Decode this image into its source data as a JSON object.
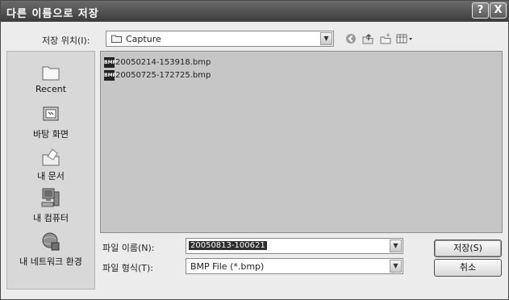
{
  "window": {
    "title": "다른 이름으로 저장",
    "help_label": "?",
    "close_label": "X"
  },
  "look_in": {
    "label": "저장 위치(I):",
    "value": "Capture"
  },
  "toolbar": {
    "icons": [
      "back-icon",
      "up-folder-icon",
      "new-folder-icon",
      "view-menu-icon"
    ]
  },
  "places": [
    {
      "label": "Recent",
      "icon": "recent-documents-icon"
    },
    {
      "label": "바탕 화면",
      "icon": "desktop-icon"
    },
    {
      "label": "내 문서",
      "icon": "my-documents-icon"
    },
    {
      "label": "내 컴퓨터",
      "icon": "my-computer-icon"
    },
    {
      "label": "내 네트워크 환경",
      "icon": "network-places-icon"
    }
  ],
  "files": [
    {
      "name": "20050214-153918.bmp",
      "type": "BMP"
    },
    {
      "name": "20050725-172725.bmp",
      "type": "BMP"
    }
  ],
  "file_name": {
    "label": "파일 이름(N):",
    "value": "20050813-100621"
  },
  "file_type": {
    "label": "파일 형식(T):",
    "value": "BMP File (*.bmp)"
  },
  "buttons": {
    "save_label": "저장(S)",
    "cancel_label": "취소"
  }
}
